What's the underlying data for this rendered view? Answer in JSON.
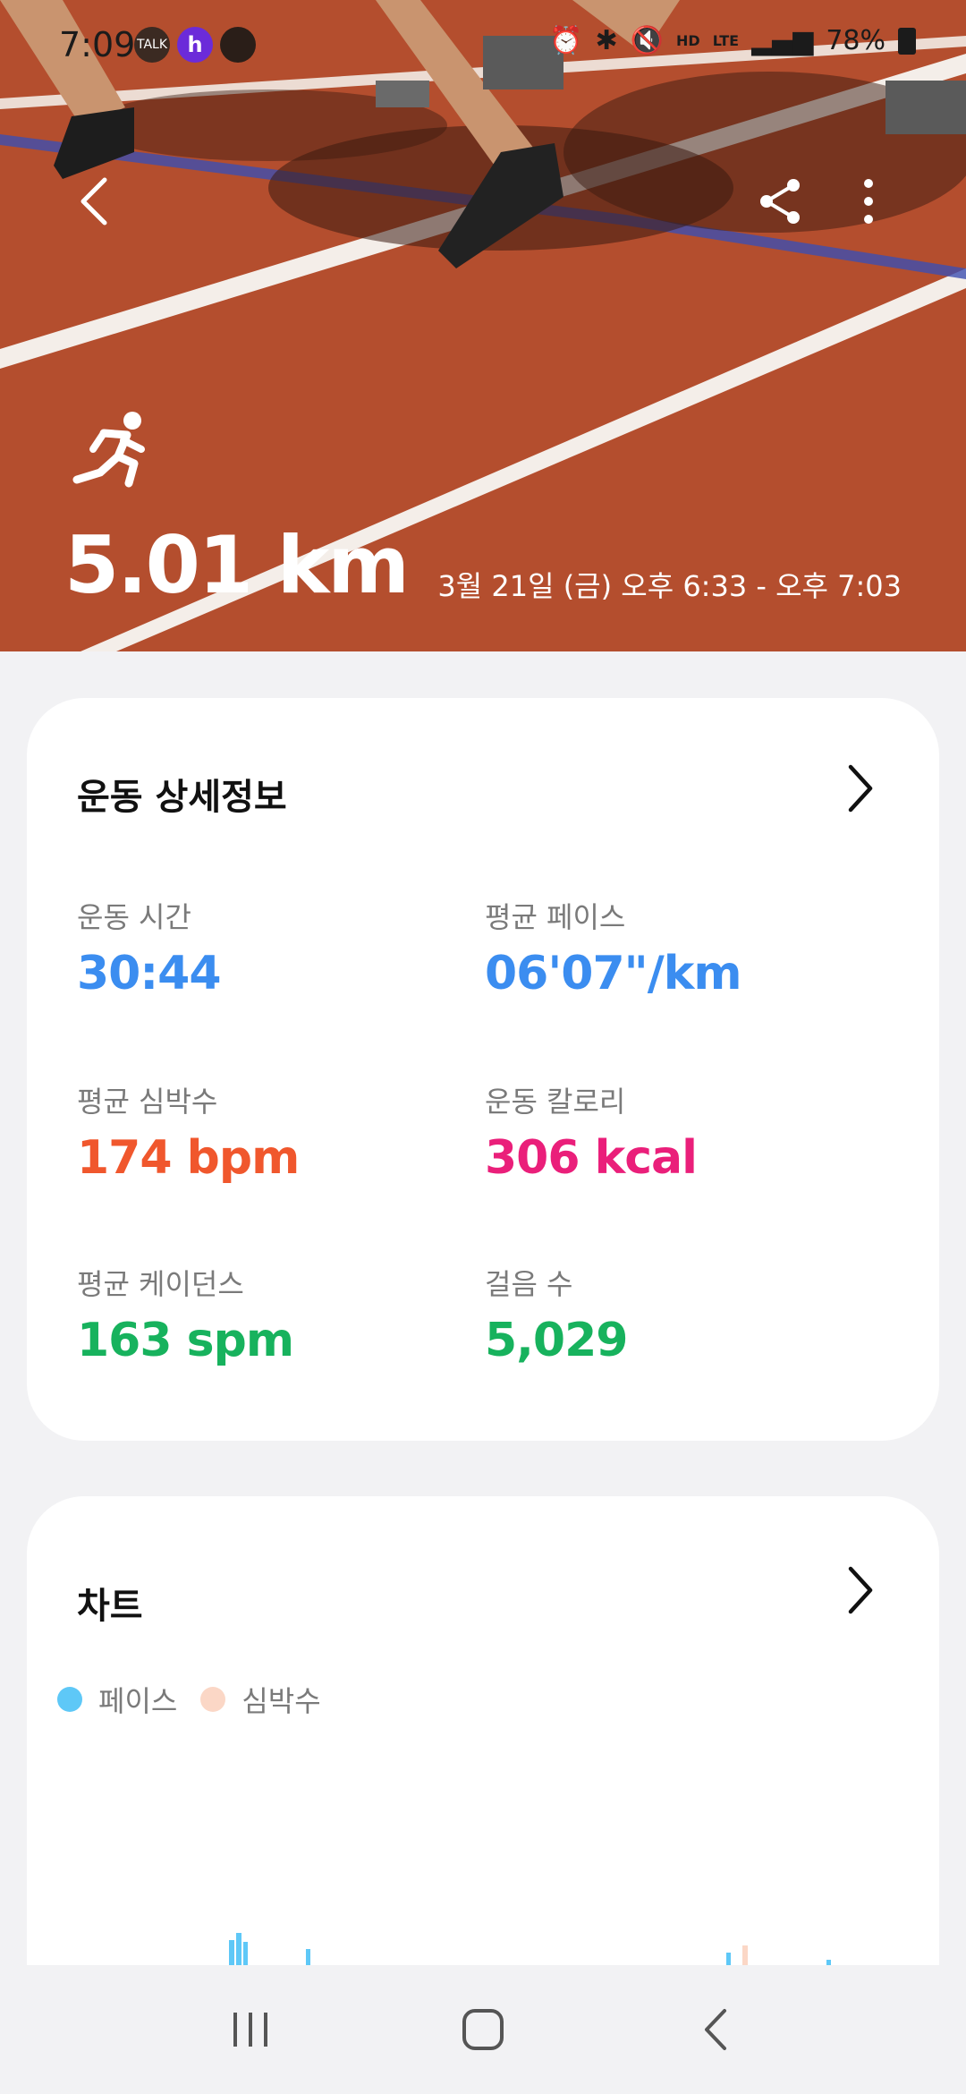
{
  "status_bar": {
    "time": "7:09",
    "apps": [
      "TALK",
      "h",
      "chat"
    ],
    "indicators": [
      "HD",
      "LTE"
    ],
    "battery": "78%"
  },
  "hero": {
    "distance": "5.01 km",
    "datetime": "3월 21일 (금) 오후 6:33 - 오후 7:03",
    "icon": "running-icon"
  },
  "details": {
    "title": "운동 상세정보",
    "metrics": [
      {
        "label": "운동 시간",
        "value": "30:44",
        "color": "#3b8df0"
      },
      {
        "label": "평균 페이스",
        "value": "06'07\"/km",
        "color": "#3b8df0"
      },
      {
        "label": "평균 심박수",
        "value": "174 bpm",
        "color": "#f0572d"
      },
      {
        "label": "운동 칼로리",
        "value": "306 kcal",
        "color": "#ea1f7a"
      },
      {
        "label": "평균 케이던스",
        "value": "163 spm",
        "color": "#17b25d"
      },
      {
        "label": "걸음 수",
        "value": "5,029",
        "color": "#17b25d"
      }
    ]
  },
  "chart": {
    "title": "차트",
    "legend": [
      {
        "label": "페이스",
        "color": "#5ec8f7"
      },
      {
        "label": "심박수",
        "color": "#fbd7c6"
      }
    ]
  },
  "nav": {
    "buttons": [
      "recent-apps-button",
      "home-button",
      "back-button"
    ]
  }
}
